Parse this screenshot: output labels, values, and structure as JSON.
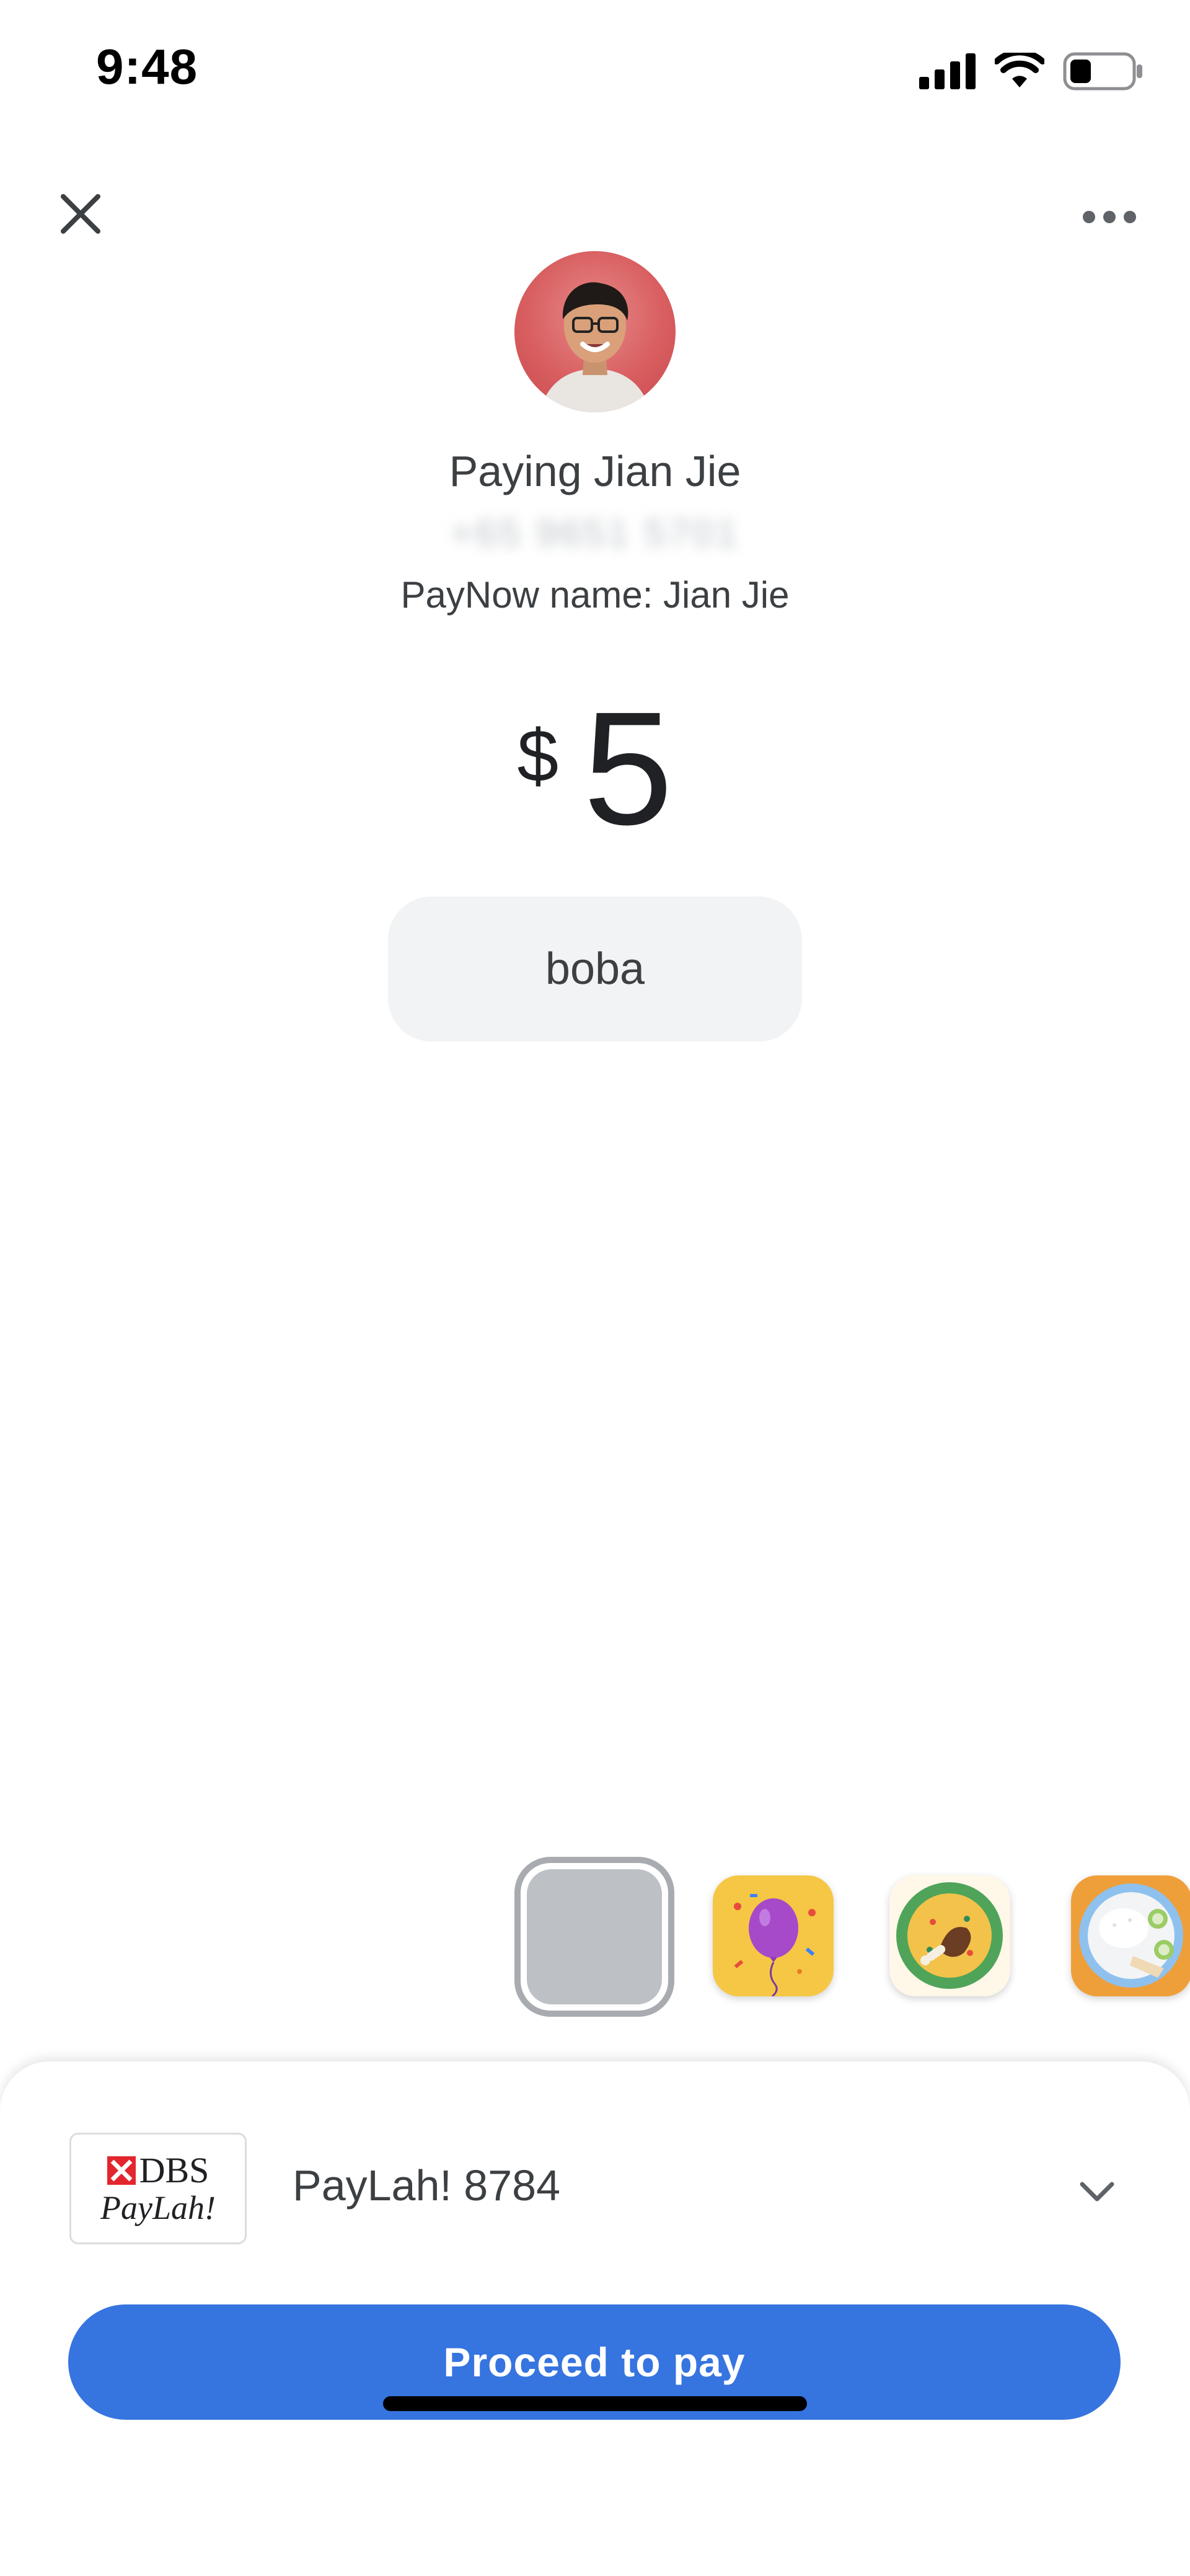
{
  "status_bar": {
    "time": "9:48",
    "icons": [
      "cellular-signal-icon",
      "wifi-icon",
      "battery-icon"
    ],
    "battery_level": 0.35
  },
  "top_bar": {
    "close_icon": "close-icon",
    "more_icon": "more-horizontal-icon"
  },
  "payee": {
    "title": "Paying Jian Jie",
    "phone": "+65 9651 5701",
    "paynow_name": "PayNow name: Jian Jie"
  },
  "payment": {
    "currency": "$",
    "amount": "5",
    "note": "boba"
  },
  "themes": [
    {
      "name": "none",
      "selected": true
    },
    {
      "name": "balloon",
      "selected": false
    },
    {
      "name": "food",
      "selected": false
    },
    {
      "name": "rice",
      "selected": false
    }
  ],
  "payment_method": {
    "logo_text_top": "DBS",
    "logo_text_bottom": "PayLah!",
    "account": "PayLah! 8784"
  },
  "action": {
    "label": "Proceed to pay",
    "color": "#3674e0"
  }
}
